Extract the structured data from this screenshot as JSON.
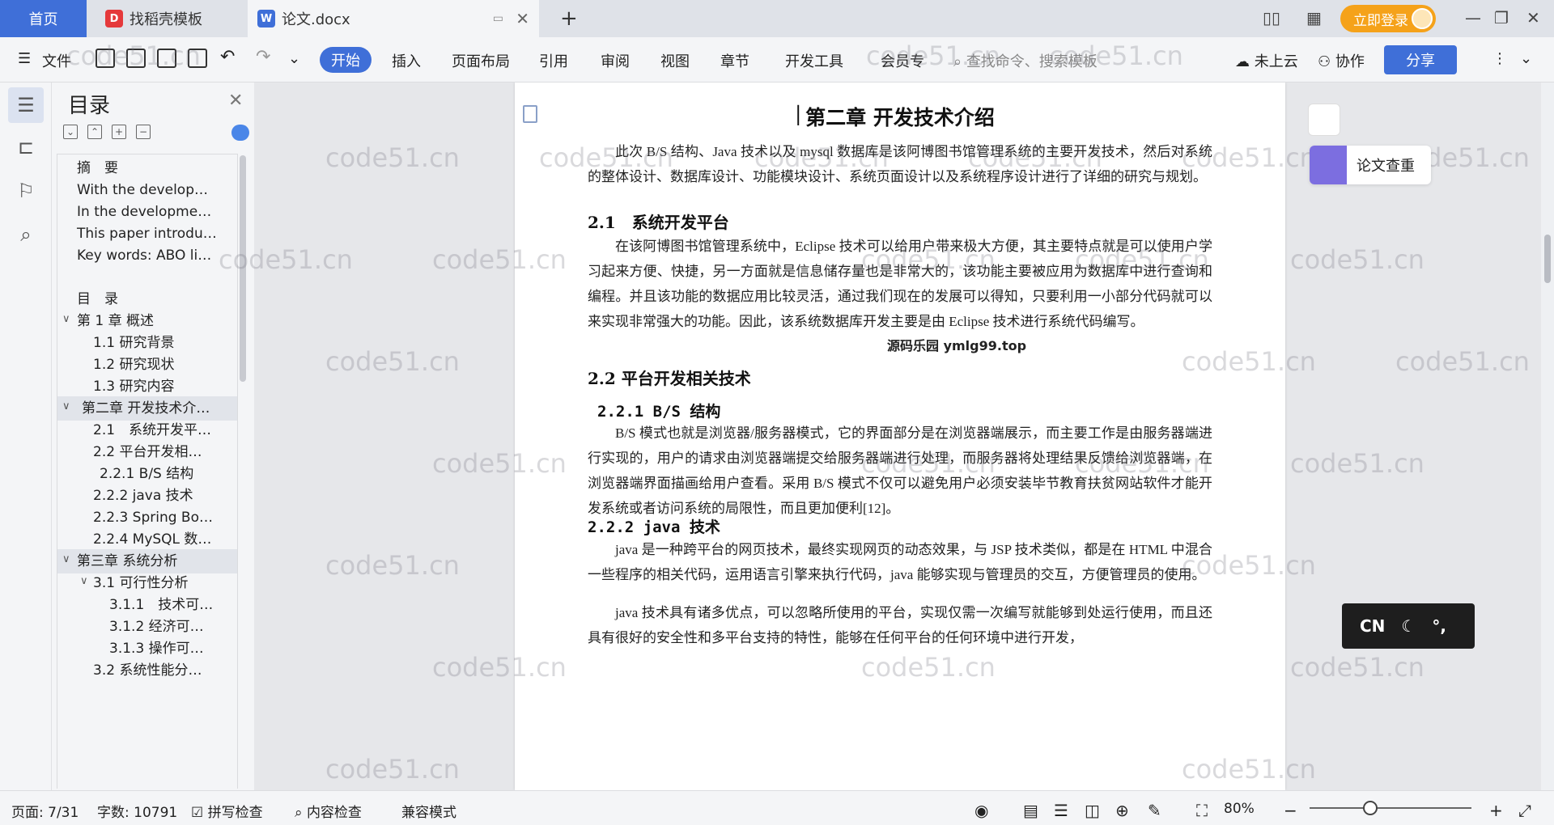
{
  "tabs": {
    "home": "首页",
    "t1": "找稻壳模板",
    "t2": "论文.docx"
  },
  "login_label": "立即登录",
  "menu": {
    "file": "文件",
    "start": "开始",
    "insert": "插入",
    "layout": "页面布局",
    "ref": "引用",
    "review": "审阅",
    "view": "视图",
    "chapter": "章节",
    "dev": "开发工具",
    "member": "会员专",
    "search_placeholder": "查找命令、搜索模板",
    "cloud": "未上云",
    "collab": "协作",
    "share": "分享"
  },
  "toc": {
    "title": "目录",
    "items": [
      "摘　要",
      "With the develop…",
      "In the developme…",
      "This paper introdu…",
      "Key words: ABO li…",
      "目　录",
      "第 1 章  概述",
      "1.1  研究背景",
      "1.2  研究现状",
      "1.3  研究内容",
      "第二章 开发技术介…",
      "2.1　系统开发平…",
      "2.2  平台开发相…",
      "2.2.1 B/S 结构",
      "2.2.2 java 技术",
      "2.2.3 Spring Bo…",
      "2.2.4 MySQL 数…",
      "第三章  系统分析",
      "3.1  可行性分析",
      "3.1.1　技术可…",
      "3.1.2  经济可…",
      "3.1.3  操作可…",
      "3.2  系统性能分…"
    ]
  },
  "doc": {
    "h1": "第二章  开发技术介绍",
    "p1": "此次 B/S 结构、Java 技术以及 mysql 数据库是该阿博图书馆管理系统的主要开发技术，然后对系统的整体设计、数据库设计、功能模块设计、系统页面设计以及系统程序设计进行了详细的研究与规划。",
    "h2_1": "2.1　系统开发平台",
    "p2": "在该阿博图书馆管理系统中，Eclipse 技术可以给用户带来极大方便，其主要特点就是可以使用户学习起来方便、快捷，另一方面就是信息储存量也是非常大的，该功能主要被应用为数据库中进行查询和编程。并且该功能的数据应用比较灵活，通过我们现在的发展可以得知，只要利用一小部分代码就可以来实现非常强大的功能。因此，该系统数据库开发主要是由 Eclipse 技术进行系统代码编写。",
    "overlay": "源码乐园 ymlg99.top",
    "h2_2": "2.2  平台开发相关技术",
    "h3_1": "2.2.1 B/S 结构",
    "p3": "B/S 模式也就是浏览器/服务器模式，它的界面部分是在浏览器端展示，而主要工作是由服务器端进行实现的，用户的请求由浏览器端提交给服务器端进行处理，而服务器将处理结果反馈给浏览器端，在浏览器端界面描画给用户查看。采用 B/S 模式不仅可以避免用户必须安装毕节教育扶贫网站软件才能开发系统或者访问系统的局限性，而且更加便利[12]。",
    "h3_2": "2.2.2  java 技术",
    "p4": "java 是一种跨平台的网页技术，最终实现网页的动态效果，与 JSP 技术类似，都是在 HTML 中混合一些程序的相关代码，运用语言引擎来执行代码，java 能够实现与管理员的交互，方便管理员的使用。",
    "p5": "java 技术具有诸多优点，可以忽略所使用的平台，实现仅需一次编写就能够到处运行使用，而且还具有很好的安全性和多平台支持的特性，能够在任何平台的任何环境中进行开发，"
  },
  "watermark": "code51.cn",
  "right_card": "论文查重",
  "ime": "CN",
  "status": {
    "page": "页面: 7/31",
    "words": "字数: 10791",
    "spell": "拼写检查",
    "content": "内容检查",
    "compat": "兼容模式",
    "zoom": "80%"
  }
}
